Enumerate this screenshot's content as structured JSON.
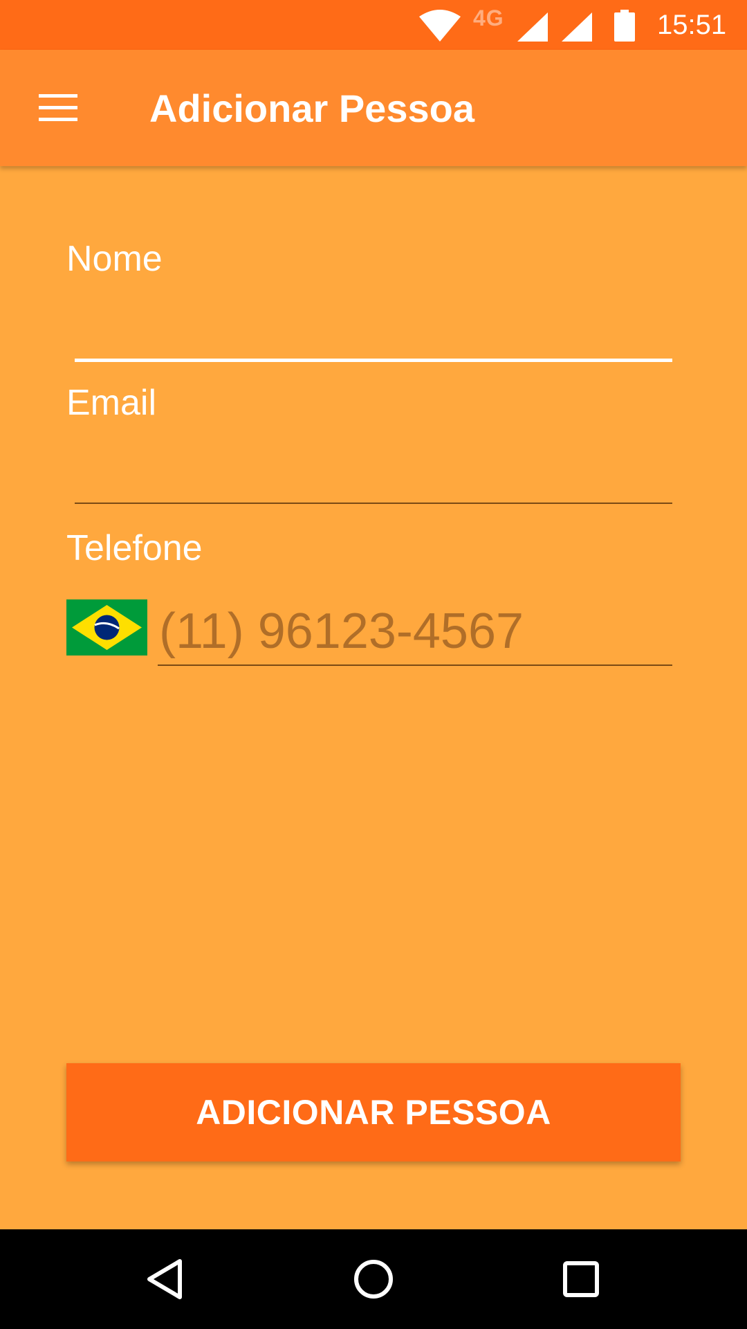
{
  "status_bar": {
    "network_label": "4G",
    "time": "15:51",
    "icons": [
      "wifi-icon",
      "signal-icon",
      "signal-icon",
      "battery-icon"
    ]
  },
  "app_bar": {
    "menu_icon": "hamburger-menu-icon",
    "title": "Adicionar Pessoa"
  },
  "form": {
    "nome": {
      "label": "Nome",
      "value": ""
    },
    "email": {
      "label": "Email",
      "value": ""
    },
    "telefone": {
      "label": "Telefone",
      "flag_icon": "brazil-flag-icon",
      "placeholder": "(11) 96123-4567",
      "value": ""
    }
  },
  "actions": {
    "add_button_label": "ADICIONAR PESSOA"
  },
  "nav_bar": {
    "icons": [
      "back-icon",
      "home-icon",
      "recents-icon"
    ]
  },
  "colors": {
    "status_bar": "#FF6B17",
    "app_bar": "#FF8A2E",
    "background": "#FFA83E",
    "button": "#FF6B17",
    "placeholder": "#B06E28",
    "nav_bar": "#000000",
    "text": "#FFFFFF"
  }
}
